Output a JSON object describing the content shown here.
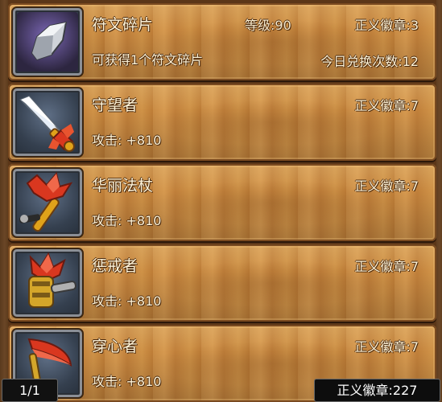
{
  "items": [
    {
      "name": "符文碎片",
      "level": "等级:90",
      "cost": "正义徽章:3",
      "sub": "可获得1个符文碎片",
      "exchange": "今日兑换次数:12",
      "icon": "rune-shard-icon"
    },
    {
      "name": "守望者",
      "cost": "正义徽章:7",
      "sub": "攻击: +810",
      "icon": "sword-icon"
    },
    {
      "name": "华丽法杖",
      "cost": "正义徽章:7",
      "sub": "攻击: +810",
      "icon": "staff-icon"
    },
    {
      "name": "惩戒者",
      "cost": "正义徽章:7",
      "sub": "攻击: +810",
      "icon": "mace-icon"
    },
    {
      "name": "穿心者",
      "cost": "正义徽章:7",
      "sub": "攻击: +810",
      "icon": "scythe-icon"
    }
  ],
  "footer": {
    "page": "1/1",
    "total": "正义徽章:227"
  }
}
